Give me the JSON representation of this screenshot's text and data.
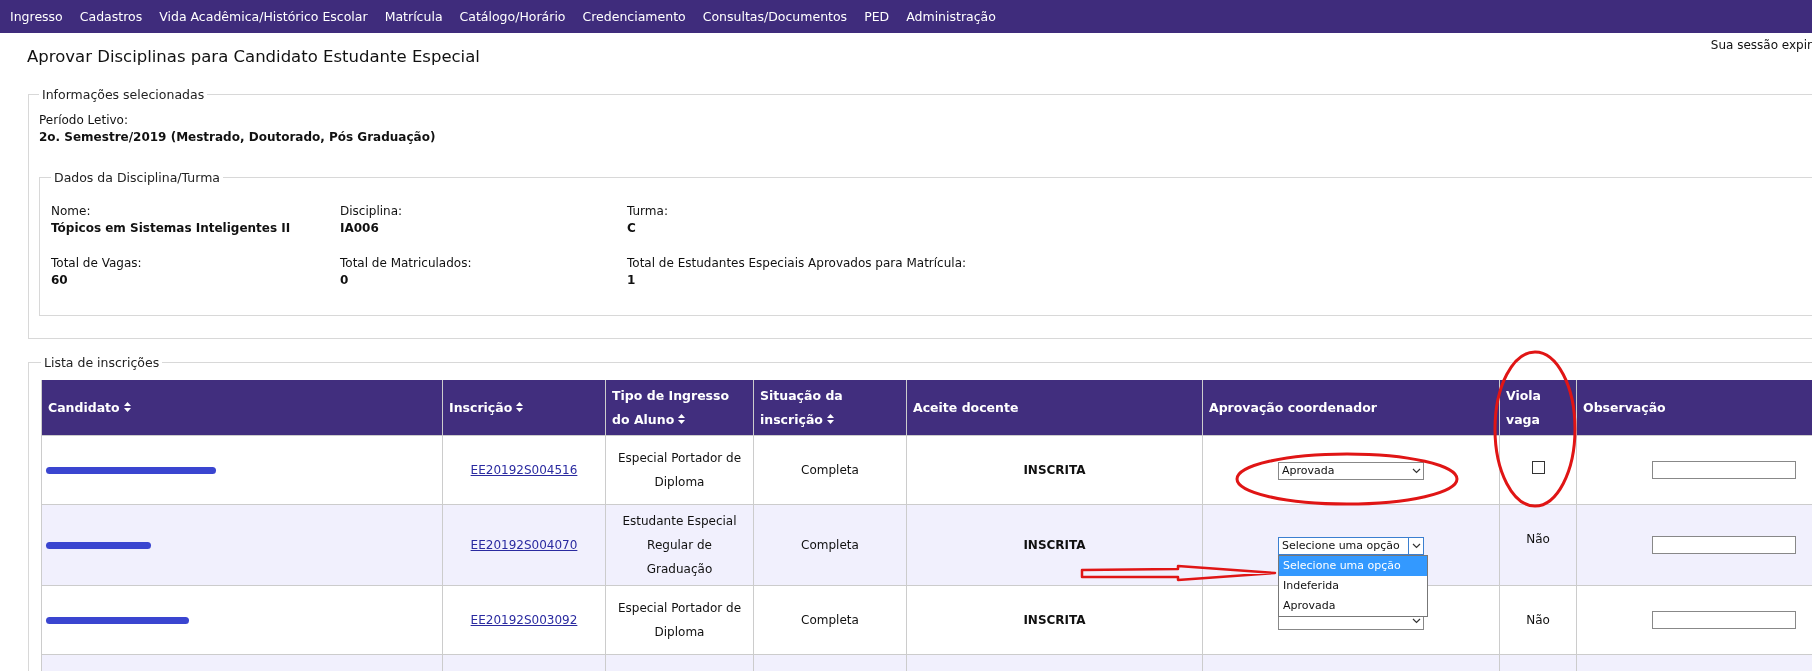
{
  "nav": {
    "items": [
      "Ingresso",
      "Cadastros",
      "Vida Acadêmica/Histórico Escolar",
      "Matrícula",
      "Catálogo/Horário",
      "Credenciamento",
      "Consultas/Documentos",
      "PED",
      "Administração"
    ]
  },
  "page_title": "Aprovar Disciplinas para Candidato Estudante Especial",
  "session_notice": "Sua sessão expir",
  "info": {
    "legend": "Informações selecionadas",
    "period_label": "Período Letivo:",
    "period_value": "2o. Semestre/2019 (Mestrado, Doutorado, Pós Graduação)",
    "discipline": {
      "legend": "Dados da Disciplina/Turma",
      "fields": [
        {
          "label": "Nome:",
          "value": "Tópicos em Sistemas Inteligentes II"
        },
        {
          "label": "Disciplina:",
          "value": "IA006"
        },
        {
          "label": "Turma:",
          "value": "C"
        },
        {
          "label": "Total de Vagas:",
          "value": "60"
        },
        {
          "label": "Total de Matriculados:",
          "value": "0"
        },
        {
          "label": "Total de Estudantes Especiais Aprovados para Matrícula:",
          "value": "1"
        }
      ]
    }
  },
  "list": {
    "legend": "Lista de inscrições",
    "columns": [
      {
        "label": "Candidato",
        "sortable": true
      },
      {
        "label": "Inscrição",
        "sortable": true
      },
      {
        "label": "Tipo de Ingresso do Aluno",
        "sortable": true
      },
      {
        "label": "Situação da inscrição",
        "sortable": true
      },
      {
        "label": "Aceite docente",
        "sortable": false
      },
      {
        "label": "Aprovação coordenador",
        "sortable": false
      },
      {
        "label": "Viola vaga",
        "sortable": false
      },
      {
        "label": "Observação",
        "sortable": false
      }
    ],
    "rows": [
      {
        "inscricao": "EE20192S004516",
        "tipo": "Especial Portador de Diploma",
        "situacao": "Completa",
        "aceite": "INSCRITA",
        "aprovacao": {
          "value": "Aprovada",
          "open": false
        },
        "viola": {
          "kind": "checkbox",
          "checked": false
        }
      },
      {
        "inscricao": "EE20192S004070",
        "tipo": "Estudante Especial Regular de Graduação",
        "situacao": "Completa",
        "aceite": "INSCRITA",
        "aprovacao": {
          "value": "Selecione uma opção",
          "open": true,
          "options": [
            {
              "label": "Selecione uma opção",
              "selected": true
            },
            {
              "label": "Indeferida",
              "selected": false
            },
            {
              "label": "Aprovada",
              "selected": false
            }
          ]
        },
        "viola": {
          "kind": "text",
          "text": "Não"
        }
      },
      {
        "inscricao": "EE20192S003092",
        "tipo": "Especial Portador de Diploma",
        "situacao": "Completa",
        "aceite": "INSCRITA",
        "aprovacao": {
          "open": false
        },
        "viola": {
          "kind": "text",
          "text": "Não"
        }
      }
    ]
  }
}
